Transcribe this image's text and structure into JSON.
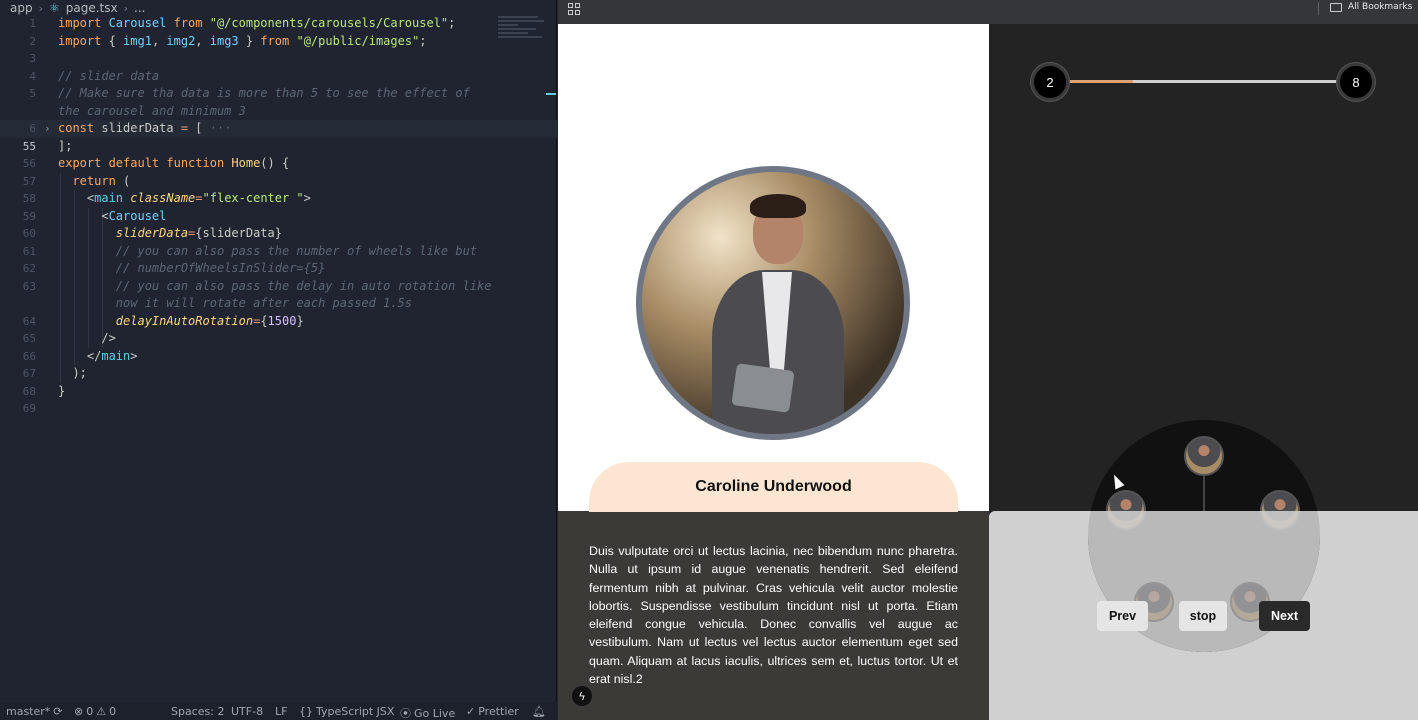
{
  "editor": {
    "breadcrumb": {
      "folder": "app",
      "file": "page.tsx",
      "more": "..."
    },
    "lines": [
      {
        "n": "1",
        "parts": [
          [
            "kw",
            "import "
          ],
          [
            "cls",
            "Carousel"
          ],
          [
            "kw",
            " from "
          ],
          [
            "str",
            "\"@/components/carousels/Carousel\""
          ],
          [
            "def",
            ";"
          ]
        ]
      },
      {
        "n": "2",
        "parts": [
          [
            "kw",
            "import "
          ],
          [
            "def",
            "{ "
          ],
          [
            "cls",
            "img1"
          ],
          [
            "def",
            ", "
          ],
          [
            "cls",
            "img2"
          ],
          [
            "def",
            ", "
          ],
          [
            "cls",
            "img3"
          ],
          [
            "def",
            " } "
          ],
          [
            "kw",
            "from "
          ],
          [
            "str",
            "\"@/public/images\""
          ],
          [
            "def",
            ";"
          ]
        ]
      },
      {
        "n": "3",
        "parts": []
      },
      {
        "n": "4",
        "parts": [
          [
            "com",
            "// slider data"
          ]
        ]
      },
      {
        "n": "5",
        "parts": [
          [
            "com",
            "// Make sure tha data is more than 5 to see the effect of"
          ]
        ]
      },
      {
        "n": "",
        "parts": [
          [
            "com",
            "the carousel and minimum 3"
          ]
        ]
      },
      {
        "n": "6",
        "fold": true,
        "parts": [
          [
            "kw",
            "const "
          ],
          [
            "def",
            "sliderData "
          ],
          [
            "op",
            "= "
          ],
          [
            "def",
            "[ "
          ],
          [
            "com",
            "···"
          ]
        ]
      },
      {
        "n": "55",
        "active": true,
        "parts": [
          [
            "def",
            "];"
          ]
        ]
      },
      {
        "n": "56",
        "parts": [
          [
            "kw",
            "export default function "
          ],
          [
            "fn",
            "Home"
          ],
          [
            "def",
            "() {"
          ]
        ]
      },
      {
        "n": "57",
        "parts": [
          [
            "def",
            "  "
          ],
          [
            "kw",
            "return "
          ],
          [
            "def",
            "("
          ]
        ]
      },
      {
        "n": "58",
        "parts": [
          [
            "def",
            "    <"
          ],
          [
            "tag",
            "main "
          ],
          [
            "attr",
            "className"
          ],
          [
            "op",
            "="
          ],
          [
            "str",
            "\"flex-center \""
          ],
          [
            "def",
            ">"
          ]
        ]
      },
      {
        "n": "59",
        "parts": [
          [
            "def",
            "      <"
          ],
          [
            "cls",
            "Carousel"
          ]
        ]
      },
      {
        "n": "60",
        "parts": [
          [
            "def",
            "        "
          ],
          [
            "attr",
            "sliderData"
          ],
          [
            "op",
            "="
          ],
          [
            "def",
            "{sliderData}"
          ]
        ]
      },
      {
        "n": "61",
        "parts": [
          [
            "def",
            "        "
          ],
          [
            "com",
            "// you can also pass the number of wheels like but"
          ]
        ]
      },
      {
        "n": "62",
        "parts": [
          [
            "def",
            "        "
          ],
          [
            "com",
            "// numberOfWheelsInSlider={5}"
          ]
        ]
      },
      {
        "n": "63",
        "parts": [
          [
            "def",
            "        "
          ],
          [
            "com",
            "// you can also pass the delay in auto rotation like"
          ]
        ]
      },
      {
        "n": "",
        "parts": [
          [
            "def",
            "        "
          ],
          [
            "com",
            "now it will rotate after each passed 1.5s"
          ]
        ]
      },
      {
        "n": "64",
        "parts": [
          [
            "def",
            "        "
          ],
          [
            "attr",
            "delayInAutoRotation"
          ],
          [
            "op",
            "="
          ],
          [
            "def",
            "{"
          ],
          [
            "num",
            "1500"
          ],
          [
            "def",
            "}"
          ]
        ]
      },
      {
        "n": "65",
        "parts": [
          [
            "def",
            "      />"
          ]
        ]
      },
      {
        "n": "66",
        "parts": [
          [
            "def",
            "    </"
          ],
          [
            "tag",
            "main"
          ],
          [
            "def",
            ">"
          ]
        ]
      },
      {
        "n": "67",
        "parts": [
          [
            "def",
            "  );"
          ]
        ]
      },
      {
        "n": "68",
        "parts": [
          [
            "def",
            "}"
          ]
        ]
      },
      {
        "n": "69",
        "parts": []
      }
    ]
  },
  "statusbar": {
    "branch": "master*",
    "errors": "0",
    "warnings": "0",
    "spaces": "Spaces: 2",
    "encoding": "UTF-8",
    "eol": "LF",
    "braces": "{}",
    "language": "TypeScript JSX",
    "golive": "Go Live",
    "prettier": "Prettier"
  },
  "browser": {
    "bookmarks_label": "All Bookmarks"
  },
  "carousel": {
    "name": "Caroline Underwood",
    "description": "Duis vulputate orci ut lectus lacinia, nec bibendum nunc pharetra. Nulla ut ipsum id augue venenatis hendrerit. Sed eleifend fermentum nibh at pulvinar. Cras vehicula velit auctor molestie lobortis. Suspendisse vestibulum tincidunt nisl ut porta. Etiam eleifend congue vehicula. Donec convallis vel augue ac vestibulum. Nam ut lectus vel lectus auctor elementum eget sed quam. Aliquam at lacus iaculis, ultrices sem et, luctus tortor. Ut et erat nisl.2",
    "progress": {
      "current": "2",
      "total": "8",
      "fraction": 0.25
    },
    "buttons": {
      "prev": "Prev",
      "stop": "stop",
      "next": "Next"
    }
  }
}
